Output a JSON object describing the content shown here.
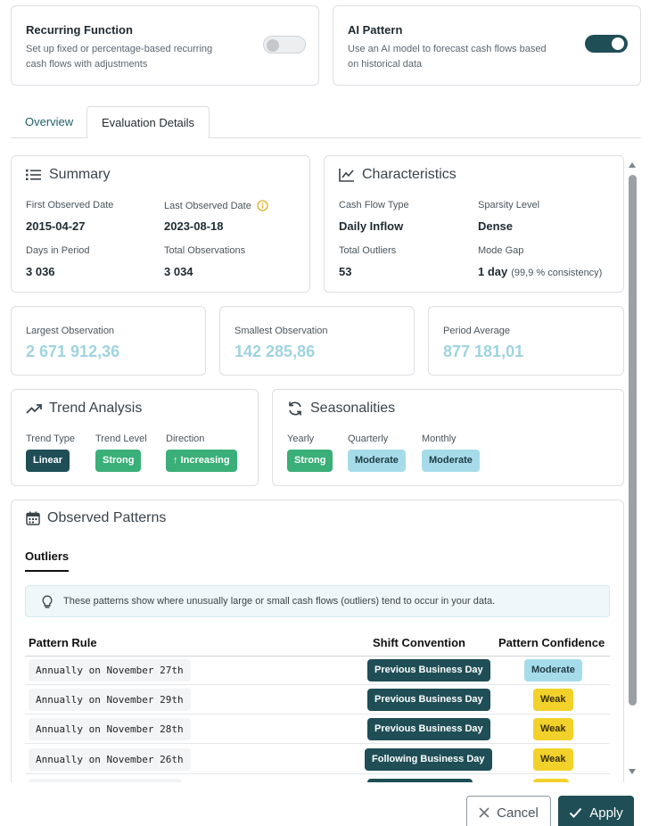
{
  "recurring": {
    "title": "Recurring Function",
    "desc_line1": "Set up fixed or percentage-based recurring",
    "desc_line2": "cash flows with adjustments"
  },
  "ai_pattern": {
    "title": "AI Pattern",
    "desc_line1": "Use an AI model to forecast cash flows based",
    "desc_line2": "on historical data"
  },
  "tabs": [
    {
      "label": "Overview"
    },
    {
      "label": "Evaluation Details"
    }
  ],
  "summary": {
    "title": "Summary",
    "first_label": "First Observed Date",
    "first_value": "2015-04-27",
    "last_label": "Last Observed Date",
    "last_value": "2023-08-18",
    "days_label": "Days in Period",
    "days_value": "3 036",
    "total_label": "Total Observations",
    "total_value": "3 034"
  },
  "characteristics": {
    "title": "Characteristics",
    "type_label": "Cash Flow Type",
    "type_value": "Daily Inflow",
    "sparsity_label": "Sparsity Level",
    "sparsity_value": "Dense",
    "outliers_label": "Total Outliers",
    "outliers_value": "53",
    "gap_label": "Mode Gap",
    "gap_value": "1 day",
    "gap_sub": "(99,9 % consistency)"
  },
  "stats": [
    {
      "label": "Largest Observation",
      "value": "2 671 912,36"
    },
    {
      "label": "Smallest Observation",
      "value": "142 285,86"
    },
    {
      "label": "Period Average",
      "value": "877 181,01"
    }
  ],
  "trend": {
    "title": "Trend Analysis",
    "type_label": "Trend Type",
    "type_value": "Linear",
    "level_label": "Trend Level",
    "level_value": "Strong",
    "dir_label": "Direction",
    "dir_value": "↑ Increasing"
  },
  "seasonalities": {
    "title": "Seasonalities",
    "yearly_label": "Yearly",
    "yearly_value": "Strong",
    "quarterly_label": "Quarterly",
    "quarterly_value": "Moderate",
    "monthly_label": "Monthly",
    "monthly_value": "Moderate"
  },
  "patterns": {
    "title": "Observed Patterns",
    "tab": "Outliers",
    "info": "These patterns show where unusually large or small cash flows (outliers) tend to occur in your data.",
    "headers": {
      "rule": "Pattern Rule",
      "shift": "Shift Convention",
      "confidence": "Pattern Confidence"
    },
    "rows": [
      {
        "rule": "Annually on November 27th",
        "shift": "Previous Business Day",
        "confidence": "Moderate"
      },
      {
        "rule": "Annually on November 29th",
        "shift": "Previous Business Day",
        "confidence": "Weak"
      },
      {
        "rule": "Annually on November 28th",
        "shift": "Previous Business Day",
        "confidence": "Weak"
      },
      {
        "rule": "Annually on November 26th",
        "shift": "Following Business Day",
        "confidence": "Weak"
      }
    ]
  },
  "footer": {
    "cancel": "Cancel",
    "apply": "Apply"
  },
  "colors": {
    "accent": "#1f4e56",
    "green": "#3aaf78",
    "light_blue": "#a6dcea",
    "yellow": "#f2d22a"
  }
}
